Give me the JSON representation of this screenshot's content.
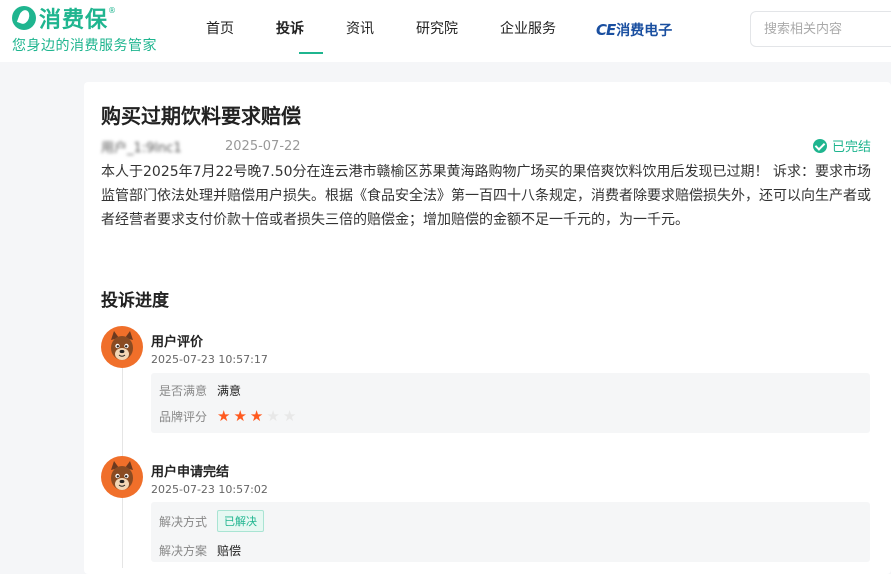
{
  "header": {
    "logo_text": "消费保",
    "logo_reg": "®",
    "slogan": "您身边的消费服务管家",
    "nav": [
      {
        "label": "首页",
        "active": false
      },
      {
        "label": "投诉",
        "active": true
      },
      {
        "label": "资讯",
        "active": false
      },
      {
        "label": "研究院",
        "active": false
      },
      {
        "label": "企业服务",
        "active": false
      }
    ],
    "ce_badge": "CE",
    "ce_text": "消费电子",
    "search_placeholder": "搜索相关内容"
  },
  "complaint": {
    "title": "购买过期饮料要求赔偿",
    "author": "用户_1:9lnc1",
    "date": "2025-07-22",
    "status": "已完结",
    "content": "本人于2025年7月22号晚7.50分在连云港市赣榆区苏果黄海路购物广场买的果倍爽饮料饮用后发现已过期！ 诉求：要求市场监管部门依法处理并赔偿用户损失。根据《食品安全法》第一百四十八条规定，消费者除要求赔偿损失外，还可以向生产者或者经营者要求支付价款十倍或者损失三倍的赔偿金；增加赔偿的金额不足一千元的，为一千元。"
  },
  "progress": {
    "title": "投诉进度",
    "items": [
      {
        "name": "用户评价",
        "time": "2025-07-23 10:57:17",
        "satisfaction_label": "是否满意",
        "satisfaction_value": "满意",
        "rating_label": "品牌评分",
        "rating": 3,
        "rating_max": 5
      },
      {
        "name": "用户申请完结",
        "time": "2025-07-23 10:57:02",
        "method_label": "解决方式",
        "method_value": "已解决",
        "plan_label": "解决方案",
        "plan_value": "赔偿"
      }
    ]
  },
  "colors": {
    "brand": "#1fb58f",
    "star": "#ff5a1f",
    "avatar": "#f06f2a"
  }
}
